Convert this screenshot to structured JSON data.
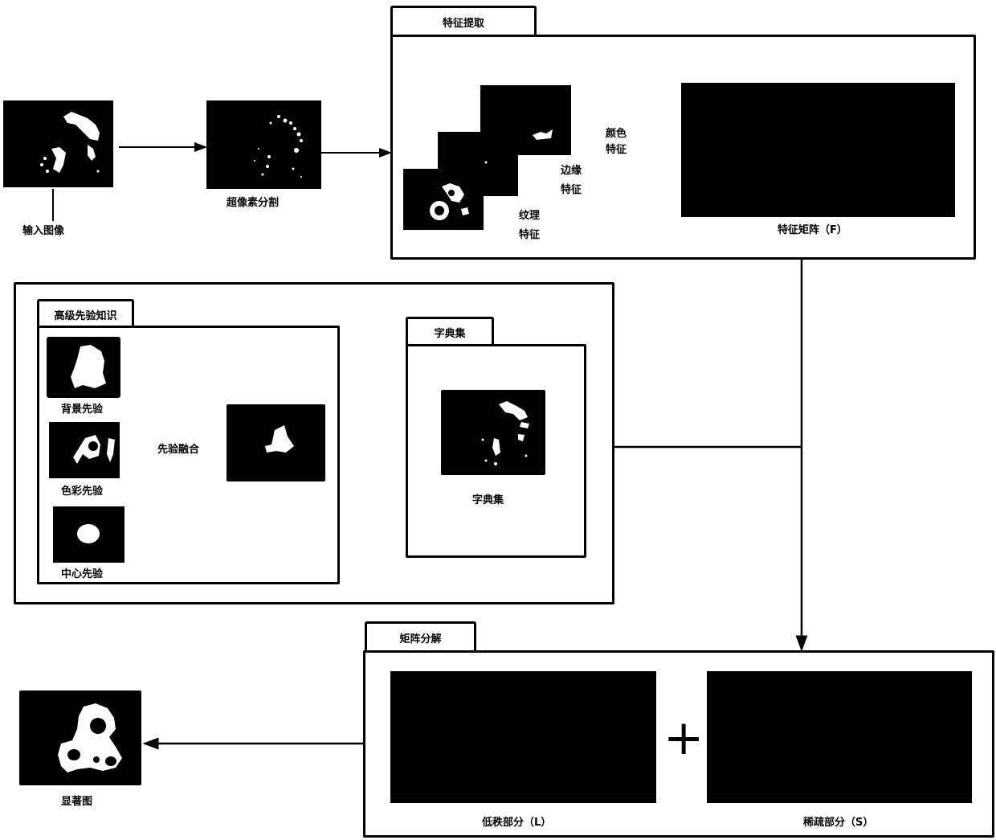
{
  "input": {
    "label": "输入图像"
  },
  "superpixel": {
    "label": "超像素分割"
  },
  "feature_extraction": {
    "title": "特征提取",
    "features": [
      {
        "label_line1": "颜色",
        "label_line2": "特征"
      },
      {
        "label_line1": "边缘",
        "label_line2": "特征"
      },
      {
        "label_line1": "纹理",
        "label_line2": "特征"
      }
    ],
    "matrix_label": "特征矩阵（F）"
  },
  "high_level_prior": {
    "title": "高级先验知识",
    "priors": [
      {
        "label": "背景先验"
      },
      {
        "label": "色彩先验"
      },
      {
        "label": "中心先验"
      }
    ],
    "fusion_label": "先验融合"
  },
  "dictionary": {
    "title": "字典集",
    "label": "字典集"
  },
  "matrix_decomposition": {
    "title": "矩阵分解",
    "operator": "+",
    "low_rank_label": "低秩部分（L）",
    "sparse_label": "稀疏部分（S）"
  },
  "output": {
    "label": "显著图"
  }
}
